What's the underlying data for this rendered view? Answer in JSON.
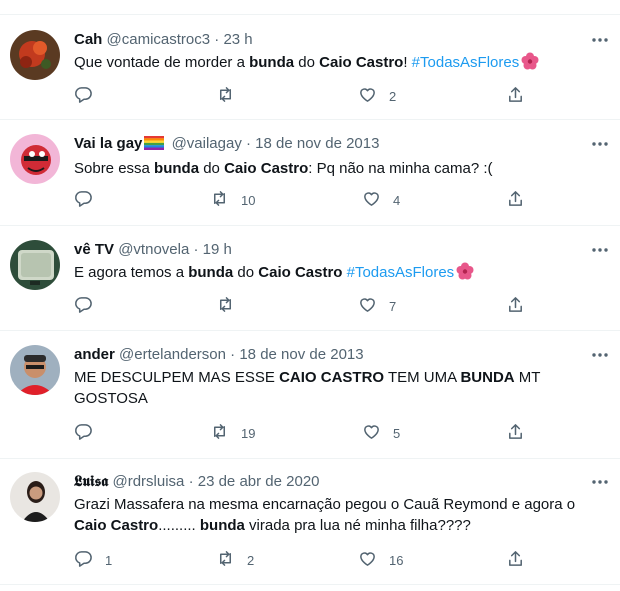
{
  "tweets": [
    {
      "name": "Cah",
      "handle": "@camicastroc3",
      "sep": "·",
      "time": "23 h",
      "text": [
        "Que vontade de morder a ",
        "bunda",
        " do ",
        "Caio Castro",
        "! ",
        "#TodasAsFlores"
      ],
      "replies": "",
      "retweets": "",
      "likes": "2"
    },
    {
      "name": "Vai la gay",
      "handle": "@vailagay",
      "sep": "·",
      "time": "18 de nov de 2013",
      "text": [
        "Sobre essa ",
        "bunda",
        " do ",
        "Caio Castro",
        ": Pq não na minha cama? :("
      ],
      "replies": "",
      "retweets": "10",
      "likes": "4"
    },
    {
      "name": "vê TV",
      "handle": "@vtnovela",
      "sep": "·",
      "time": "19 h",
      "text": [
        "E agora temos a ",
        "bunda",
        " do ",
        "Caio Castro",
        " ",
        "#TodasAsFlores"
      ],
      "replies": "",
      "retweets": "",
      "likes": "7"
    },
    {
      "name": "ander",
      "handle": "@ertelanderson",
      "sep": "·",
      "time": "18 de nov de 2013",
      "text": [
        "ME DESCULPEM MAS ESSE ",
        "CAIO CASTRO",
        " TEM UMA ",
        "BUNDA",
        " MT GOSTOSA"
      ],
      "replies": "",
      "retweets": "19",
      "likes": "5"
    },
    {
      "name": "𝕷𝖚𝖎𝖘𝖆",
      "handle": "@rdrsluisa",
      "sep": "·",
      "time": "23 de abr de 2020",
      "text": [
        "Grazi Massafera na mesma encarnação pegou o Cauã Reymond e agora o ",
        "Caio Castro",
        "......... ",
        "bunda",
        " virada pra lua né minha filha????"
      ],
      "replies": "1",
      "retweets": "2",
      "likes": "16"
    }
  ],
  "icons": {
    "reply": "reply-icon",
    "retweet": "retweet-icon",
    "like": "heart-icon",
    "share": "share-icon",
    "more": "more-icon"
  },
  "colors": {
    "text": "#0f1419",
    "muted": "#536471",
    "link": "#1d9bf0",
    "divider": "#eff3f4"
  }
}
